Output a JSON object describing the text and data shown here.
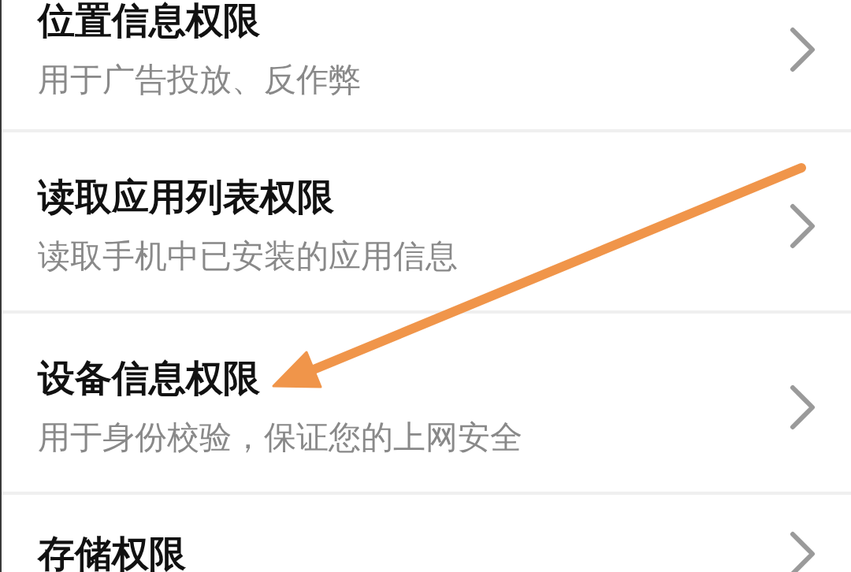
{
  "permissions": [
    {
      "title": "位置信息权限",
      "description": "用于广告投放、反作弊",
      "marked_by_arrow": false
    },
    {
      "title": "读取应用列表权限",
      "description": "读取手机中已安装的应用信息",
      "marked_by_arrow": false
    },
    {
      "title": "设备信息权限",
      "description": "用于身份校验，保证您的上网安全",
      "marked_by_arrow": true
    },
    {
      "title": "存储权限",
      "marked_by_arrow": false
    }
  ]
}
